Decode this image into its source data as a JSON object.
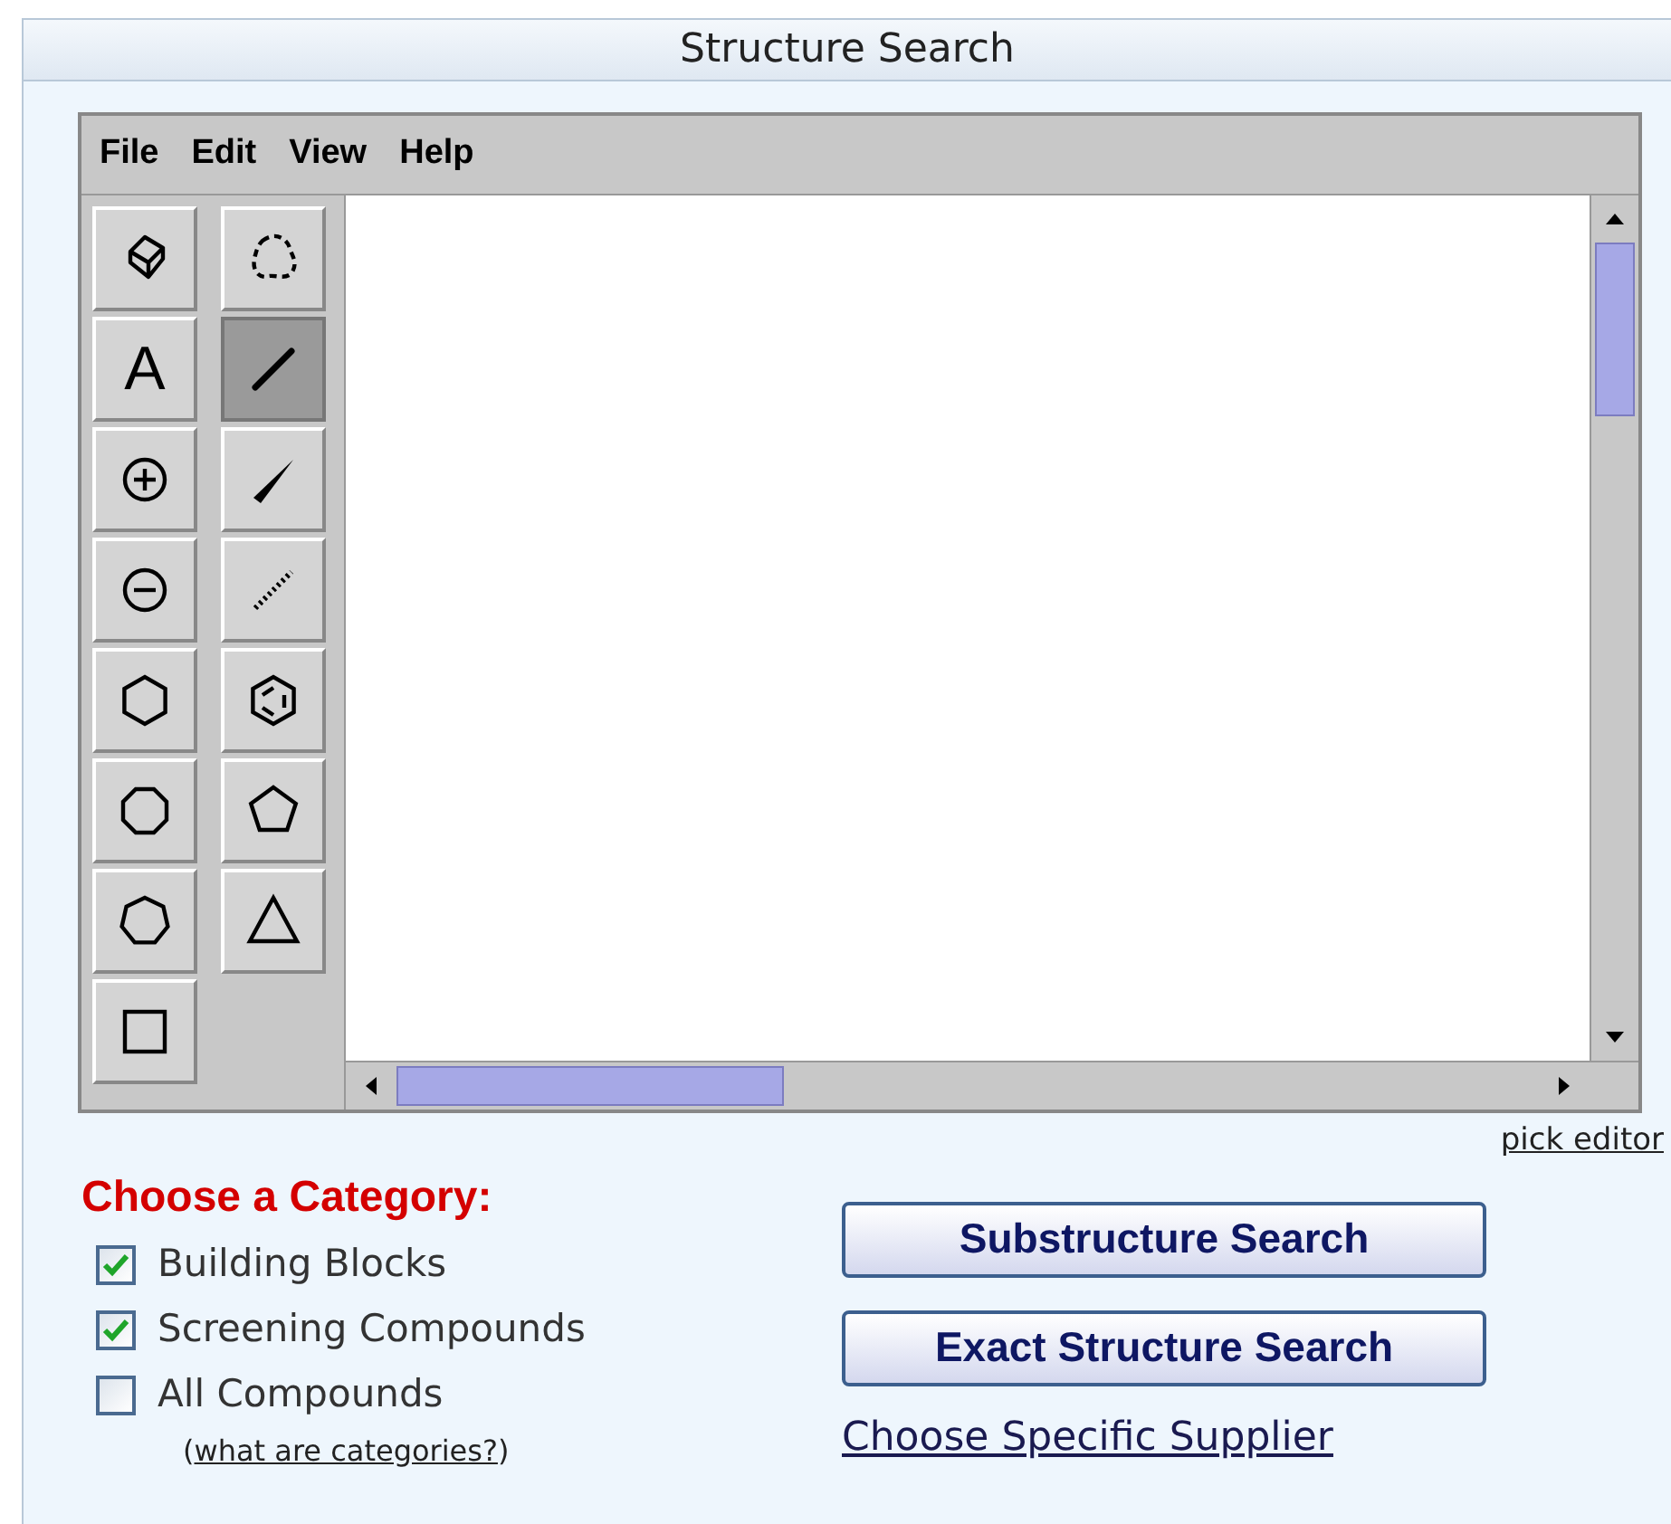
{
  "title": "Structure Search",
  "editor": {
    "menu": [
      "File",
      "Edit",
      "View",
      "Help"
    ],
    "tools": [
      {
        "kind": "eraser",
        "selected": false
      },
      {
        "kind": "lasso",
        "selected": false
      },
      {
        "kind": "text",
        "label": "A",
        "selected": false
      },
      {
        "kind": "bond",
        "selected": true
      },
      {
        "kind": "plus",
        "selected": false
      },
      {
        "kind": "wedge",
        "selected": false
      },
      {
        "kind": "minus",
        "selected": false
      },
      {
        "kind": "hash",
        "selected": false
      },
      {
        "kind": "hexagon",
        "selected": false
      },
      {
        "kind": "aromatic",
        "selected": false
      },
      {
        "kind": "octagon",
        "selected": false
      },
      {
        "kind": "pentagon",
        "selected": false
      },
      {
        "kind": "heptagon",
        "selected": false
      },
      {
        "kind": "triangle",
        "selected": false
      },
      {
        "kind": "square",
        "selected": false
      }
    ]
  },
  "pick_editor": "pick editor",
  "category": {
    "heading": "Choose a Category:",
    "options": [
      {
        "label": "Building Blocks",
        "checked": true
      },
      {
        "label": "Screening Compounds",
        "checked": true
      },
      {
        "label": "All Compounds",
        "checked": false
      }
    ],
    "help": {
      "before": "(",
      "link": "what are categories?",
      "after": ")"
    }
  },
  "buttons": [
    "Substructure Search",
    "Exact Structure Search"
  ],
  "supplier_link": "Choose Specific Supplier"
}
